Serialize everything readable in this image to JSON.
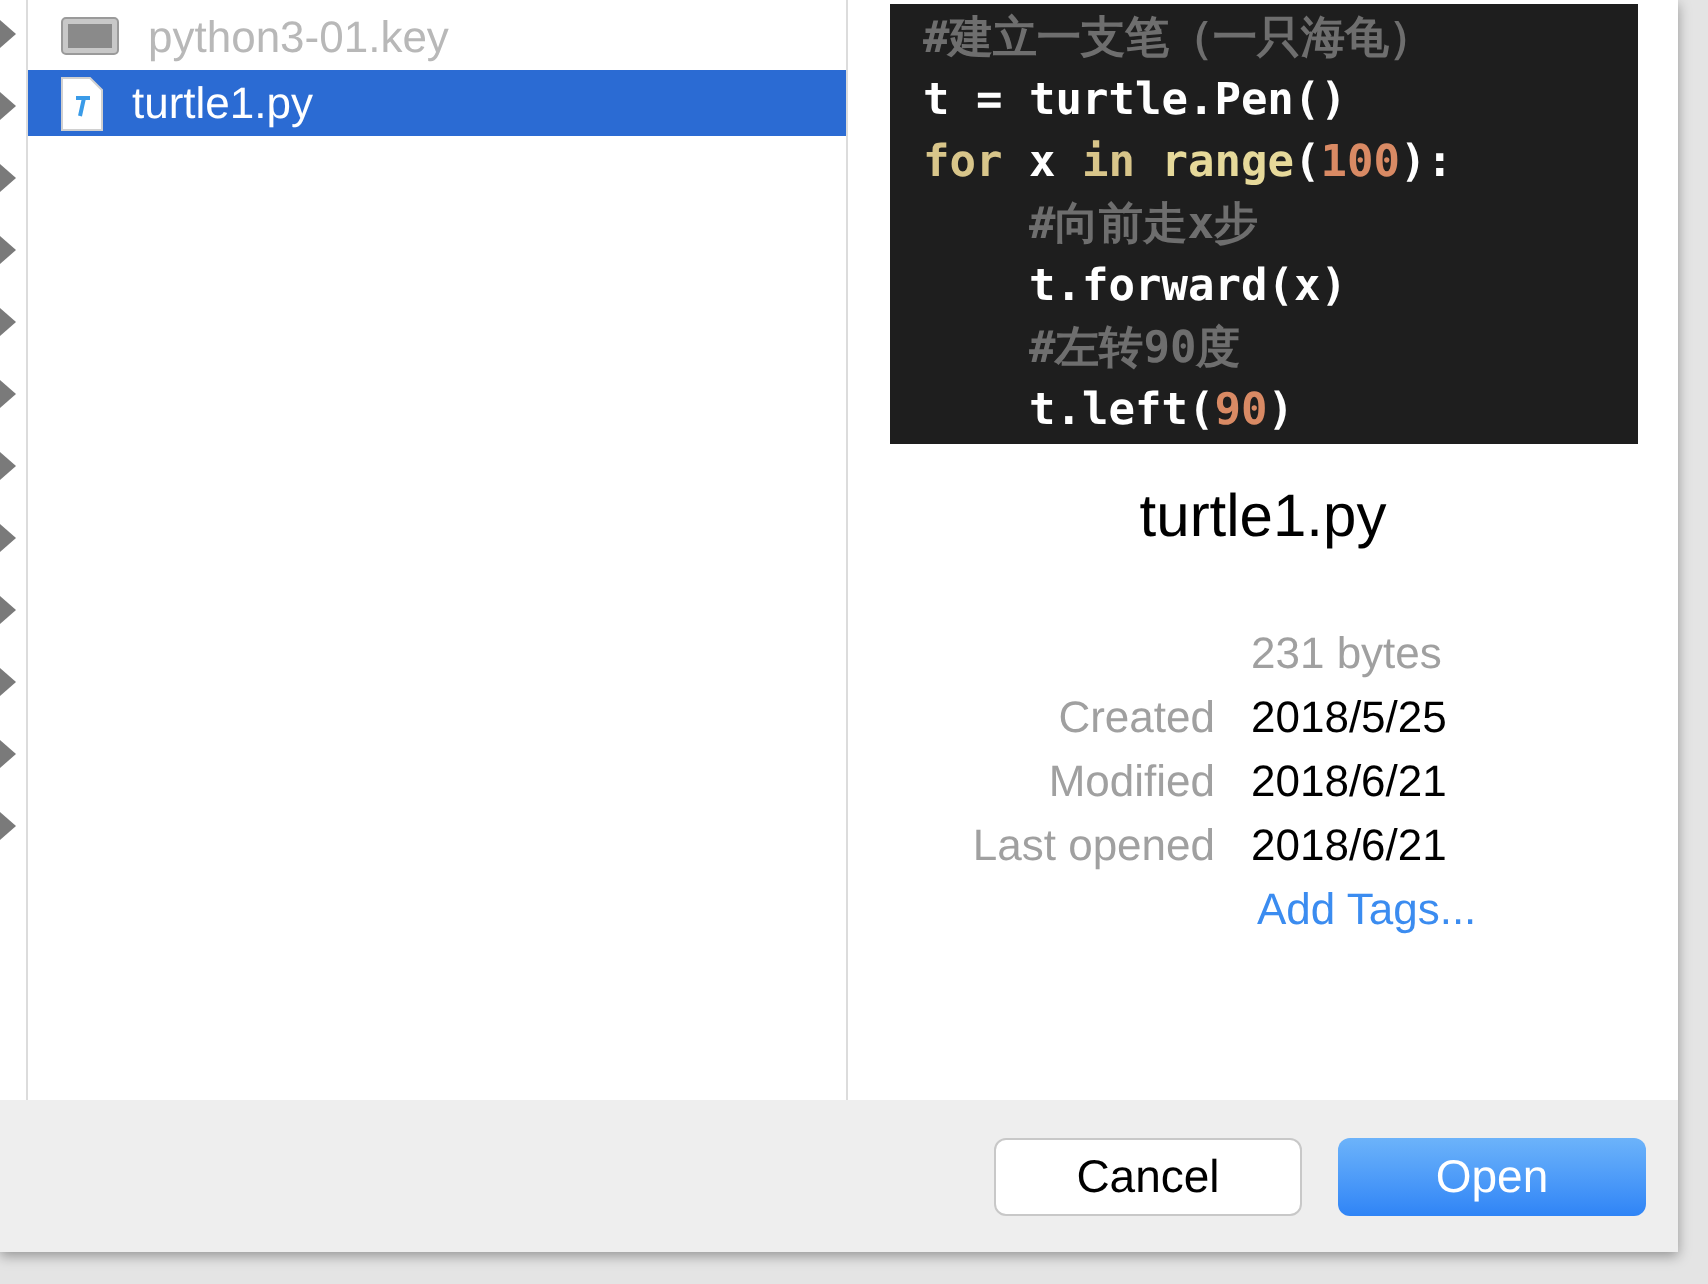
{
  "file_list": [
    {
      "name": "python3-01.key",
      "kind": "keynote",
      "selected": false,
      "disabled": true
    },
    {
      "name": "turtle1.py",
      "kind": "python",
      "selected": true,
      "disabled": false
    }
  ],
  "preview": {
    "code_lines": [
      {
        "indented": false,
        "tokens": [
          {
            "text": "#建立一支笔（一只海龟）",
            "kind": "comment"
          }
        ]
      },
      {
        "indented": false,
        "tokens": [
          {
            "text": "t = turtle.Pen()",
            "kind": "plain"
          }
        ]
      },
      {
        "indented": false,
        "tokens": [
          {
            "text": "for",
            "kind": "keyword"
          },
          {
            "text": " x ",
            "kind": "plain"
          },
          {
            "text": "in ",
            "kind": "keyword"
          },
          {
            "text": "range",
            "kind": "builtin"
          },
          {
            "text": "(",
            "kind": "plain"
          },
          {
            "text": "100",
            "kind": "number"
          },
          {
            "text": "):",
            "kind": "plain"
          }
        ]
      },
      {
        "indented": true,
        "tokens": [
          {
            "text": "#向前走x步",
            "kind": "comment"
          }
        ]
      },
      {
        "indented": true,
        "tokens": [
          {
            "text": "t.forward(x)",
            "kind": "plain"
          }
        ]
      },
      {
        "indented": true,
        "tokens": [
          {
            "text": "#左转90度",
            "kind": "comment"
          }
        ]
      },
      {
        "indented": true,
        "tokens": [
          {
            "text": "t.left(",
            "kind": "plain"
          },
          {
            "text": "90",
            "kind": "number"
          },
          {
            "text": ")",
            "kind": "plain"
          }
        ]
      }
    ],
    "file_name": "turtle1.py",
    "size": "231 bytes",
    "info": [
      {
        "label": "Created",
        "value": "2018/5/25"
      },
      {
        "label": "Modified",
        "value": "2018/6/21"
      },
      {
        "label": "Last opened",
        "value": "2018/6/21"
      }
    ],
    "add_tags": "Add Tags..."
  },
  "buttons": [
    {
      "label": "Cancel",
      "kind": "secondary"
    },
    {
      "label": "Open",
      "kind": "primary"
    }
  ]
}
